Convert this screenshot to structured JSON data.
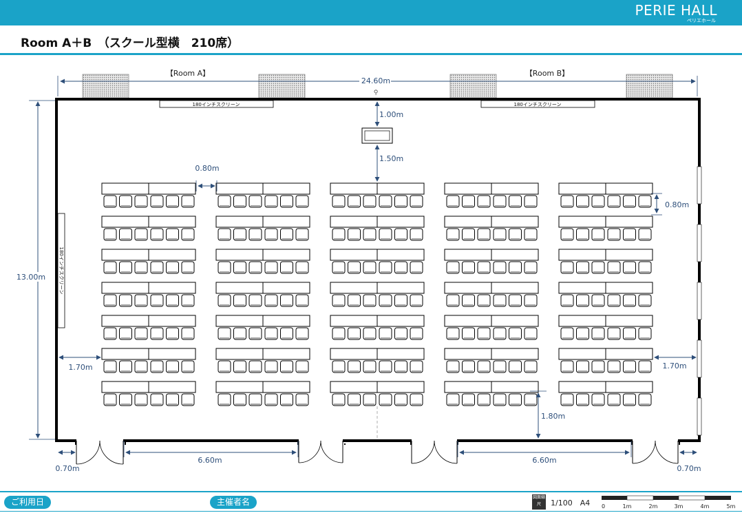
{
  "header": {
    "brand_name": "PERIE HALL",
    "brand_kana": "ペリエホール",
    "title": "Room A＋B　（スクール型横　210席）"
  },
  "plan": {
    "room_a_label": "【Room A】",
    "room_b_label": "【Room B】",
    "screen_label": "180インチスクリーン",
    "dimensions": {
      "width_total": "24.60m",
      "height_total": "13.00m",
      "podium_gap": "1.00m",
      "front_gap": "1.50m",
      "aisle": "0.80m",
      "row_pitch": "0.80m",
      "side_left": "1.70m",
      "side_right": "1.70m",
      "back_gap": "1.80m",
      "door_left": "0.70m",
      "door_right": "0.70m",
      "wall_left": "6.60m",
      "wall_right": "6.60m"
    },
    "layout": {
      "columns": 5,
      "rows": 7,
      "seats_per_table": 3,
      "tables_per_block": 2
    }
  },
  "footer": {
    "date_label": "ご利用日",
    "organizer_label": "主催者名",
    "scale_box": "図面縮尺",
    "scale_text": "1/100　A4",
    "scale_ticks": [
      "0",
      "1m",
      "2m",
      "3m",
      "4m",
      "5m"
    ]
  },
  "colors": {
    "accent": "#1aa3c8",
    "dimension": "#2e4f7a"
  }
}
